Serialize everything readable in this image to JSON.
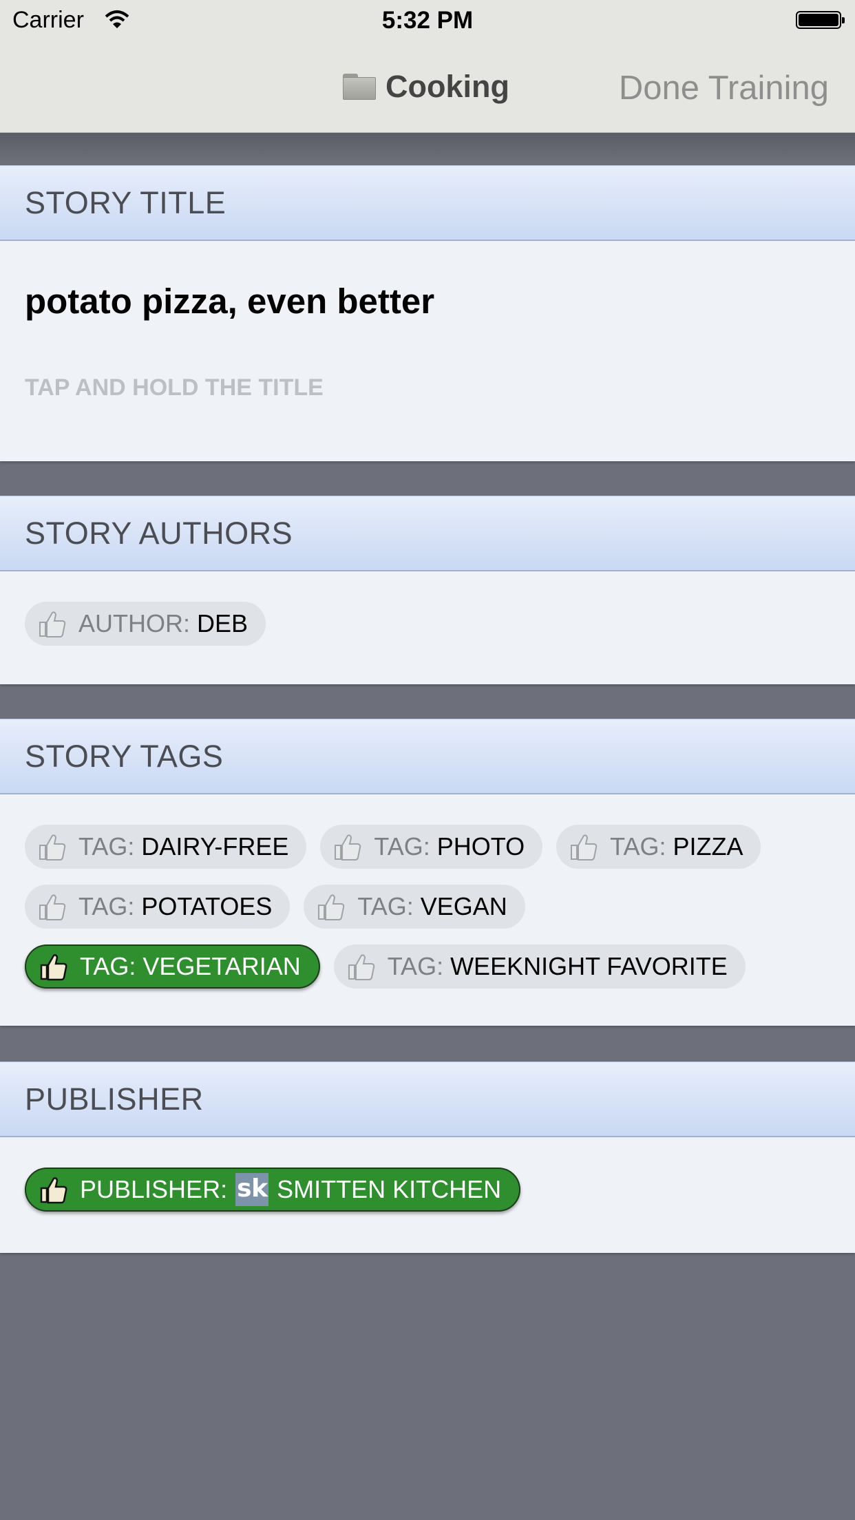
{
  "status_bar": {
    "carrier": "Carrier",
    "time": "5:32 PM"
  },
  "nav": {
    "title": "Cooking",
    "done_label": "Done Training"
  },
  "sections": {
    "title": {
      "header": "STORY TITLE",
      "story_title": "potato pizza, even better",
      "hint": "TAP AND HOLD THE TITLE"
    },
    "authors": {
      "header": "STORY AUTHORS",
      "items": [
        {
          "label": "AUTHOR:",
          "value": "DEB",
          "liked": false
        }
      ]
    },
    "tags": {
      "header": "STORY TAGS",
      "items": [
        {
          "label": "TAG:",
          "value": "DAIRY-FREE",
          "liked": false
        },
        {
          "label": "TAG:",
          "value": "PHOTO",
          "liked": false
        },
        {
          "label": "TAG:",
          "value": "PIZZA",
          "liked": false
        },
        {
          "label": "TAG:",
          "value": "POTATOES",
          "liked": false
        },
        {
          "label": "TAG:",
          "value": "VEGAN",
          "liked": false
        },
        {
          "label": "TAG:",
          "value": "VEGETARIAN",
          "liked": true
        },
        {
          "label": "TAG:",
          "value": "WEEKNIGHT FAVORITE",
          "liked": false
        }
      ]
    },
    "publisher": {
      "header": "PUBLISHER",
      "items": [
        {
          "label": "PUBLISHER:",
          "value": "SMITTEN KITCHEN",
          "liked": true,
          "icon": "smitten-kitchen-favicon"
        }
      ]
    }
  },
  "colors": {
    "liked_bg": "#2f8f2f",
    "pill_bg": "#dfe2e6",
    "header_gradient_top": "#e7eefb",
    "header_gradient_bottom": "#c9d8f3",
    "backdrop": "#6d707a"
  }
}
